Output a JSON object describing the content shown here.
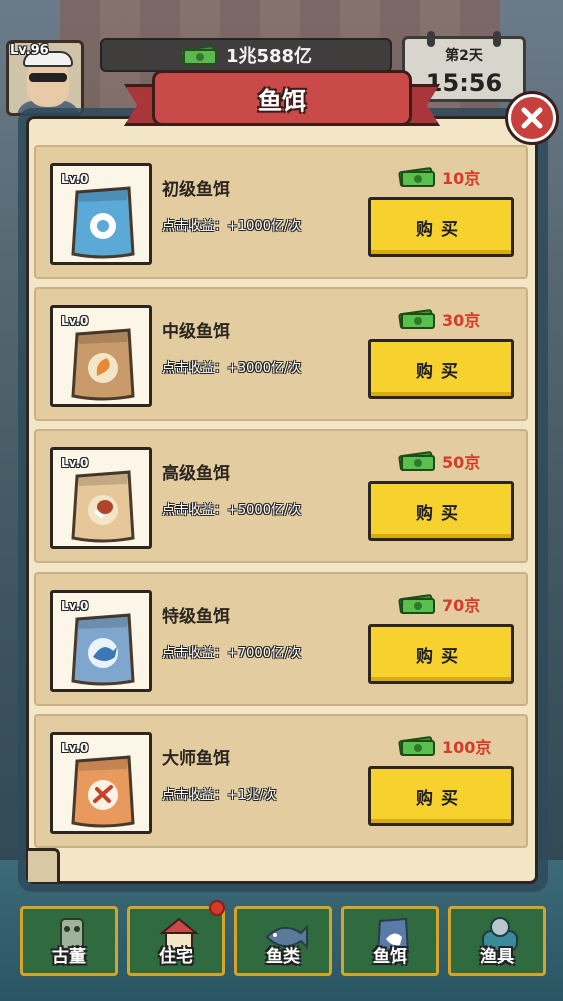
{
  "hud": {
    "level": "Lv.96",
    "money": "1兆588亿",
    "day": "第2天",
    "time": "15:56"
  },
  "dialog": {
    "title": "鱼饵",
    "items": [
      {
        "level": "Lv.0",
        "name": "初级鱼饵",
        "income": "点击收益：+1000亿/次",
        "price": "10京",
        "buy_label": "购买",
        "bag_color": "#5aa9d6",
        "emblem": "ring"
      },
      {
        "level": "Lv.0",
        "name": "中级鱼饵",
        "income": "点击收益：+3000亿/次",
        "price": "30京",
        "buy_label": "购买",
        "bag_color": "#c99a6a",
        "emblem": "shrimp"
      },
      {
        "level": "Lv.0",
        "name": "高级鱼饵",
        "income": "点击收益：+5000亿/次",
        "price": "50京",
        "buy_label": "购买",
        "bag_color": "#e6c79a",
        "emblem": "meat"
      },
      {
        "level": "Lv.0",
        "name": "特级鱼饵",
        "income": "点击收益：+7000亿/次",
        "price": "70京",
        "buy_label": "购买",
        "bag_color": "#7fa6cc",
        "emblem": "fish"
      },
      {
        "level": "Lv.0",
        "name": "大师鱼饵",
        "income": "点击收益：+1兆/次",
        "price": "100京",
        "buy_label": "购买",
        "bag_color": "#e89a5e",
        "emblem": "bone"
      }
    ]
  },
  "tabs": [
    {
      "label": "古董",
      "icon": "antique-icon"
    },
    {
      "label": "住宅",
      "icon": "house-icon",
      "notification": true
    },
    {
      "label": "鱼类",
      "icon": "fish-icon"
    },
    {
      "label": "鱼饵",
      "icon": "bait-icon"
    },
    {
      "label": "渔具",
      "icon": "gear-icon"
    }
  ],
  "colors": {
    "price": "#d63a28",
    "buy_button": "#f7d22e",
    "ribbon": "#c94a48",
    "panel": "#f3e6c6",
    "tab_bg": "#2f6b3e"
  }
}
